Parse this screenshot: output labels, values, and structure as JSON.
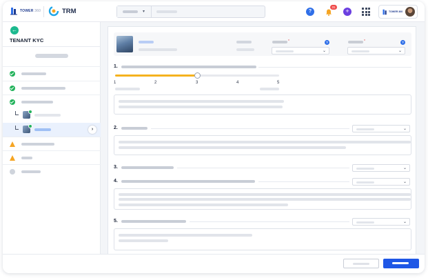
{
  "header": {
    "logo_primary_text": "TOWER",
    "logo_primary_suffix": "360",
    "app_title": "TRM",
    "help_glyph": "?",
    "notifications_count": "31",
    "profile_logo_text": "TOWER 360"
  },
  "sidebar": {
    "back_glyph": "←",
    "title": "TENANT KYC",
    "items": [
      {
        "status": "complete"
      },
      {
        "status": "complete"
      },
      {
        "status": "complete"
      },
      {
        "status": "complete",
        "type": "sub"
      },
      {
        "status": "complete",
        "type": "sub",
        "active": true,
        "nav_glyph": "›"
      },
      {
        "status": "warning"
      },
      {
        "status": "warning"
      },
      {
        "status": "pending"
      }
    ]
  },
  "questions": [
    {
      "number": "1.",
      "type": "slider",
      "ticks": [
        "1",
        "2",
        "3",
        "4",
        "5"
      ],
      "value": 3
    },
    {
      "number": "2.",
      "type": "dropdown_text"
    },
    {
      "number": "3.",
      "type": "dropdown"
    },
    {
      "number": "4.",
      "type": "dropdown_text"
    },
    {
      "number": "5.",
      "type": "dropdown_text"
    }
  ],
  "colors": {
    "accent": "#1f57e6",
    "success": "#22b25b",
    "warning": "#f5a524",
    "slider": "#f5b21e"
  }
}
